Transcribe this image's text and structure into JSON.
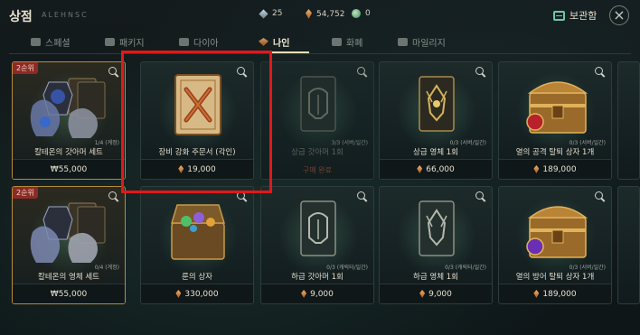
{
  "header": {
    "title": "상점",
    "subtitle": "ALEHNSC",
    "currencies": [
      {
        "icon": "diamond-icon",
        "value": "25"
      },
      {
        "icon": "nain-coin-icon",
        "value": "54,752"
      },
      {
        "icon": "globe-icon",
        "value": "0"
      }
    ],
    "storage_label": "보관함",
    "close_label": "×"
  },
  "tabs": [
    {
      "label": "스페셜",
      "icon": "thumbs-up-icon"
    },
    {
      "label": "패키지",
      "icon": "package-icon"
    },
    {
      "label": "다이아",
      "icon": "diamond-icon"
    },
    {
      "label": "나인",
      "icon": "nain-coin-icon",
      "active": true
    },
    {
      "label": "화폐",
      "icon": "coins-icon"
    },
    {
      "label": "마일리지",
      "icon": "mileage-icon"
    }
  ],
  "products": [
    {
      "name": "칼테온의 갓아머 세트",
      "price": "₩55,000",
      "currency": "krw",
      "badge": "2순위",
      "limit": "1/4 (계정)",
      "art": "armor-set"
    },
    {
      "name": "장비 강화 주문서 (각인)",
      "price": "19,000",
      "currency": "nain",
      "badge": "",
      "limit": "",
      "art": "scroll"
    },
    {
      "name": "상급 갓아머 1회",
      "price": "",
      "currency": "",
      "badge": "",
      "limit": "3/3 (서버/일간)",
      "sold_out": "구매 완료",
      "art": "card-helmet",
      "dim": true
    },
    {
      "name": "상급 영체 1회",
      "price": "66,000",
      "currency": "nain",
      "badge": "",
      "limit": "0/3 (서버/일간)",
      "art": "card-spirit"
    },
    {
      "name": "열의 공격 탈퇴 상자 1개",
      "price": "189,000",
      "currency": "nain",
      "badge": "",
      "limit": "0/3 (서버/일간)",
      "art": "chest-red"
    },
    {
      "name": "칼테온의 영체 세트",
      "price": "₩55,000",
      "currency": "krw",
      "badge": "2순위",
      "limit": "0/4 (계정)",
      "art": "spirit-set"
    },
    {
      "name": "룬의 상자",
      "price": "330,000",
      "currency": "nain",
      "badge": "",
      "limit": "",
      "art": "chest-runes"
    },
    {
      "name": "하급 갓아머 1회",
      "price": "9,000",
      "currency": "nain",
      "badge": "",
      "limit": "0/3 (캐릭터/일간)",
      "art": "card-helmet"
    },
    {
      "name": "하급 영체 1회",
      "price": "9,000",
      "currency": "nain",
      "badge": "",
      "limit": "0/3 (캐릭터/일간)",
      "art": "card-spirit"
    },
    {
      "name": "열의 방어 탈퇴 상자 1개",
      "price": "189,000",
      "currency": "nain",
      "badge": "",
      "limit": "0/3 (서버/일간)",
      "art": "chest-purple"
    }
  ]
}
